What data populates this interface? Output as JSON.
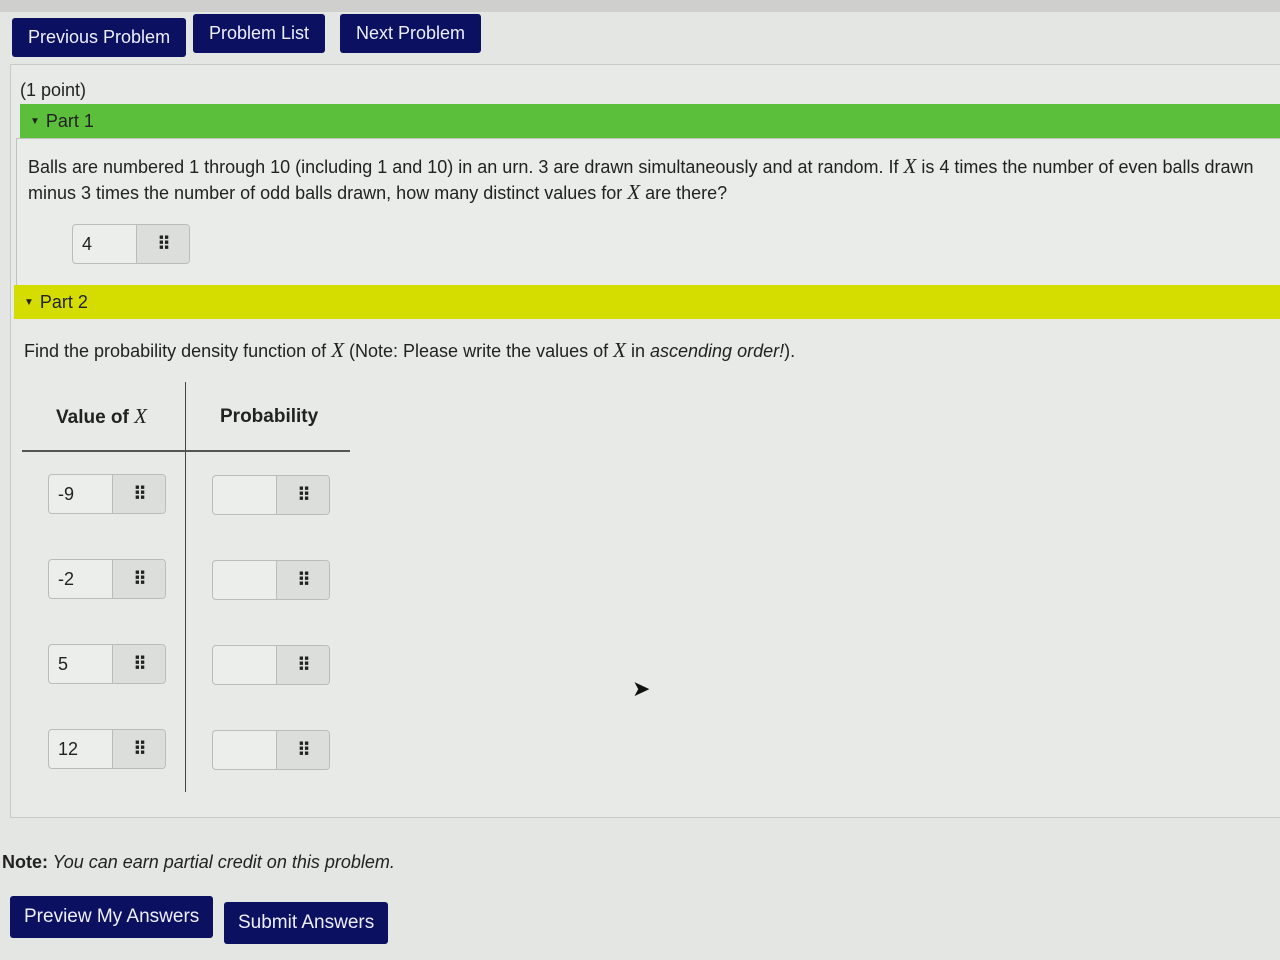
{
  "nav": {
    "previous": "Previous Problem",
    "list": "Problem List",
    "next": "Next Problem"
  },
  "points": "(1 point)",
  "part1": {
    "label": "Part 1",
    "question_a": "Balls are numbered 1 through 10 (including 1 and 10) in an urn. 3 are drawn simultaneously and at random. If ",
    "var": "X",
    "question_b": " is 4 times the number of even balls drawn minus 3 times the number of odd balls drawn, how many distinct values for ",
    "question_c": " are there?",
    "answer": "4"
  },
  "part2": {
    "label": "Part 2",
    "instr_a": "Find the probability density function of ",
    "var": "X",
    "instr_b": " (Note: Please write the values of ",
    "instr_c": " in ",
    "instr_em": "ascending order!",
    "instr_d": ").",
    "col_value": "Value of ",
    "col_prob": "Probability",
    "rows": [
      {
        "value": "-9",
        "prob": ""
      },
      {
        "value": "-2",
        "prob": ""
      },
      {
        "value": "5",
        "prob": ""
      },
      {
        "value": "12",
        "prob": ""
      }
    ]
  },
  "note": {
    "label": "Note:",
    "text": " You can earn partial credit on this problem."
  },
  "buttons": {
    "preview": "Preview My Answers",
    "submit": "Submit Answers"
  },
  "colors": {
    "nav": "#0b1060",
    "part1": "#5cbf3c",
    "part2": "#d4dc00"
  },
  "grid_icon": "⠿"
}
